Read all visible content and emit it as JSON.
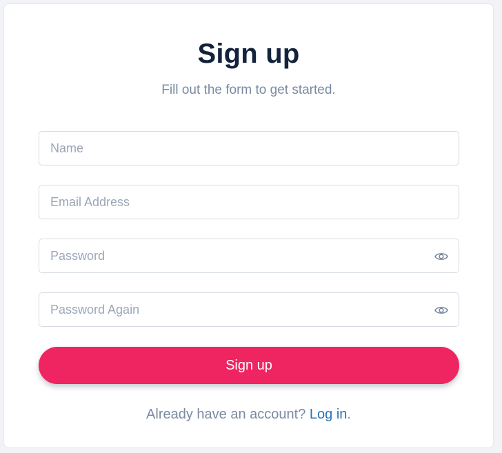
{
  "form": {
    "title": "Sign up",
    "subtitle": "Fill out the form to get started.",
    "fields": {
      "name": {
        "placeholder": "Name",
        "value": ""
      },
      "email": {
        "placeholder": "Email Address",
        "value": ""
      },
      "password": {
        "placeholder": "Password",
        "value": "",
        "icon": "eye-icon"
      },
      "password_again": {
        "placeholder": "Password Again",
        "value": "",
        "icon": "eye-icon"
      }
    },
    "submit_label": "Sign up",
    "footer": {
      "prompt": "Already have an account?",
      "link_label": "Log in",
      "suffix": "."
    }
  },
  "colors": {
    "accent": "#ee2561",
    "title": "#14233b",
    "muted_text": "#7a8aa1",
    "link": "#2a72b6",
    "border": "#d6dbe3"
  }
}
